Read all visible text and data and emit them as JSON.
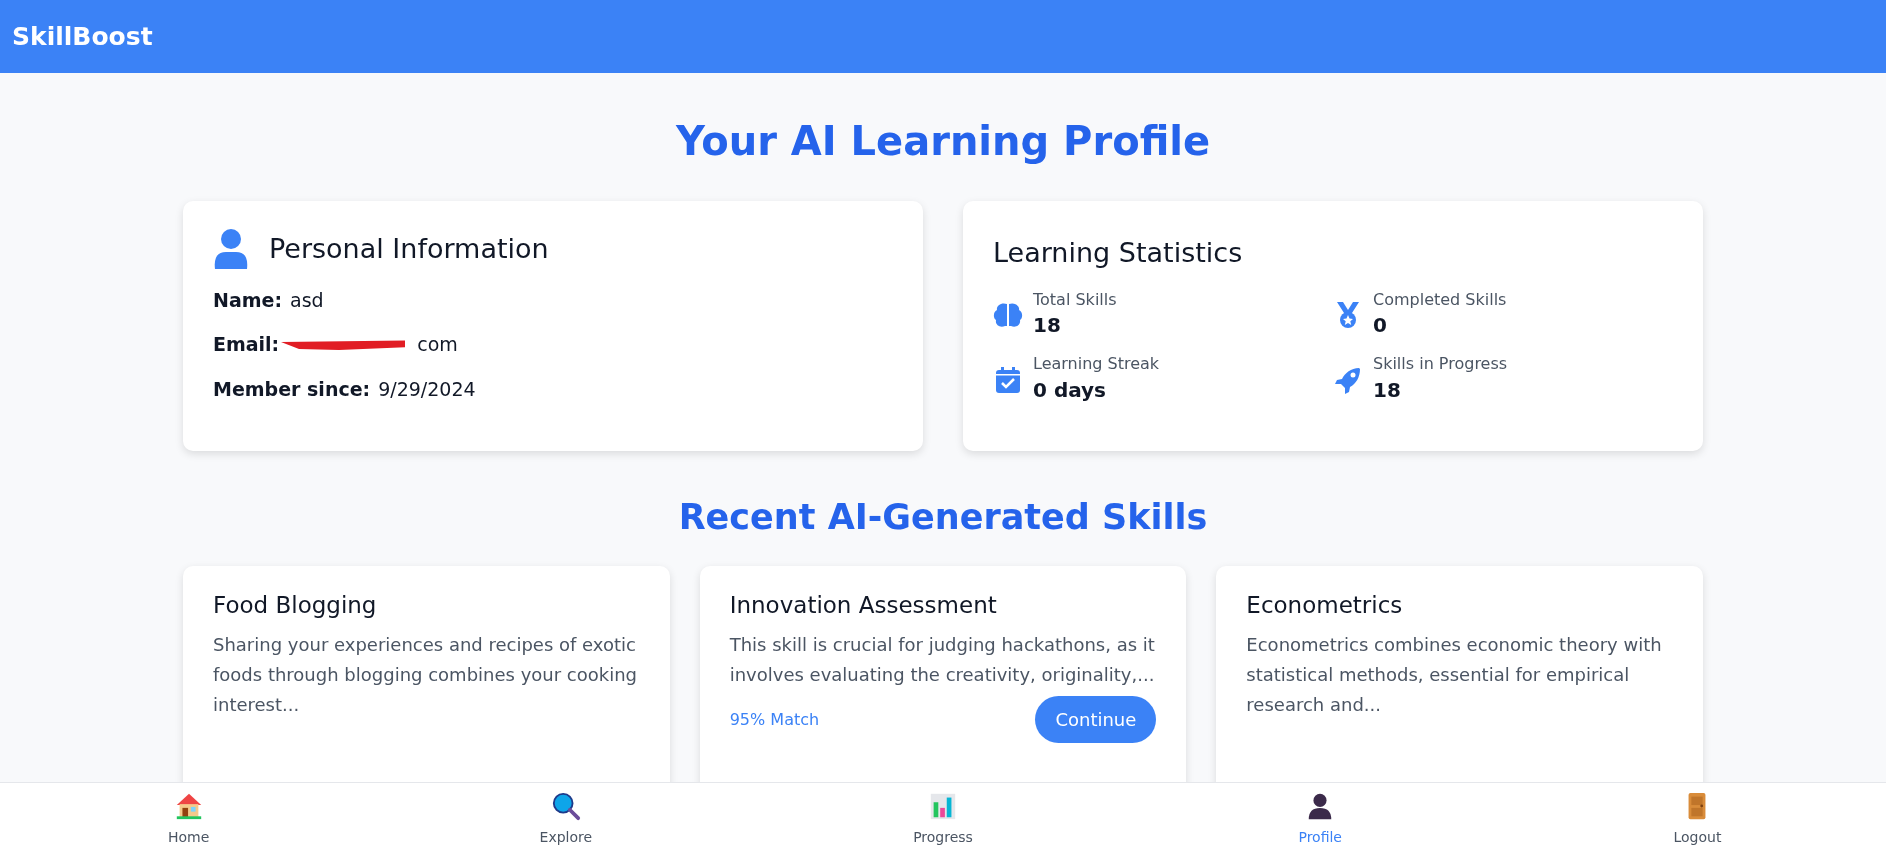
{
  "brand": "SkillBoost",
  "page_title": "Your AI Learning Profile",
  "personal": {
    "title": "Personal Information",
    "fields": [
      {
        "kind": "text",
        "label": "Name:",
        "value": "asd"
      },
      {
        "kind": "redacted",
        "label": "Email:",
        "value": "com"
      },
      {
        "kind": "text",
        "label": "Member since:",
        "value": "9/29/2024"
      }
    ]
  },
  "stats": {
    "title": "Learning Statistics",
    "items": [
      {
        "kind": "brain",
        "label": "Total Skills",
        "value": "18"
      },
      {
        "kind": "medal",
        "label": "Completed Skills",
        "value": "0"
      },
      {
        "kind": "calendar",
        "label": "Learning Streak",
        "value": "0 days"
      },
      {
        "kind": "rocket",
        "label": "Skills in Progress",
        "value": "18"
      }
    ]
  },
  "skills_title": "Recent AI-Generated Skills",
  "skills": [
    {
      "title": "Food Blogging",
      "description": "Sharing your experiences and recipes of exotic foods through blogging combines your cooking interest..."
    },
    {
      "title": "Innovation Assessment",
      "description": "This skill is crucial for judging hackathons, as it involves evaluating the creativity, originality,...",
      "match": "95% Match",
      "button": "Continue"
    },
    {
      "title": "Econometrics",
      "description": "Econometrics combines economic theory with statistical methods, essential for empirical research and..."
    }
  ],
  "bottom_nav": [
    {
      "kind": "home",
      "label": "Home",
      "selected": false
    },
    {
      "kind": "explore",
      "label": "Explore",
      "selected": false
    },
    {
      "kind": "progress",
      "label": "Progress",
      "selected": false
    },
    {
      "kind": "profile",
      "label": "Profile",
      "selected": true
    },
    {
      "kind": "logout",
      "label": "Logout",
      "selected": false
    }
  ]
}
